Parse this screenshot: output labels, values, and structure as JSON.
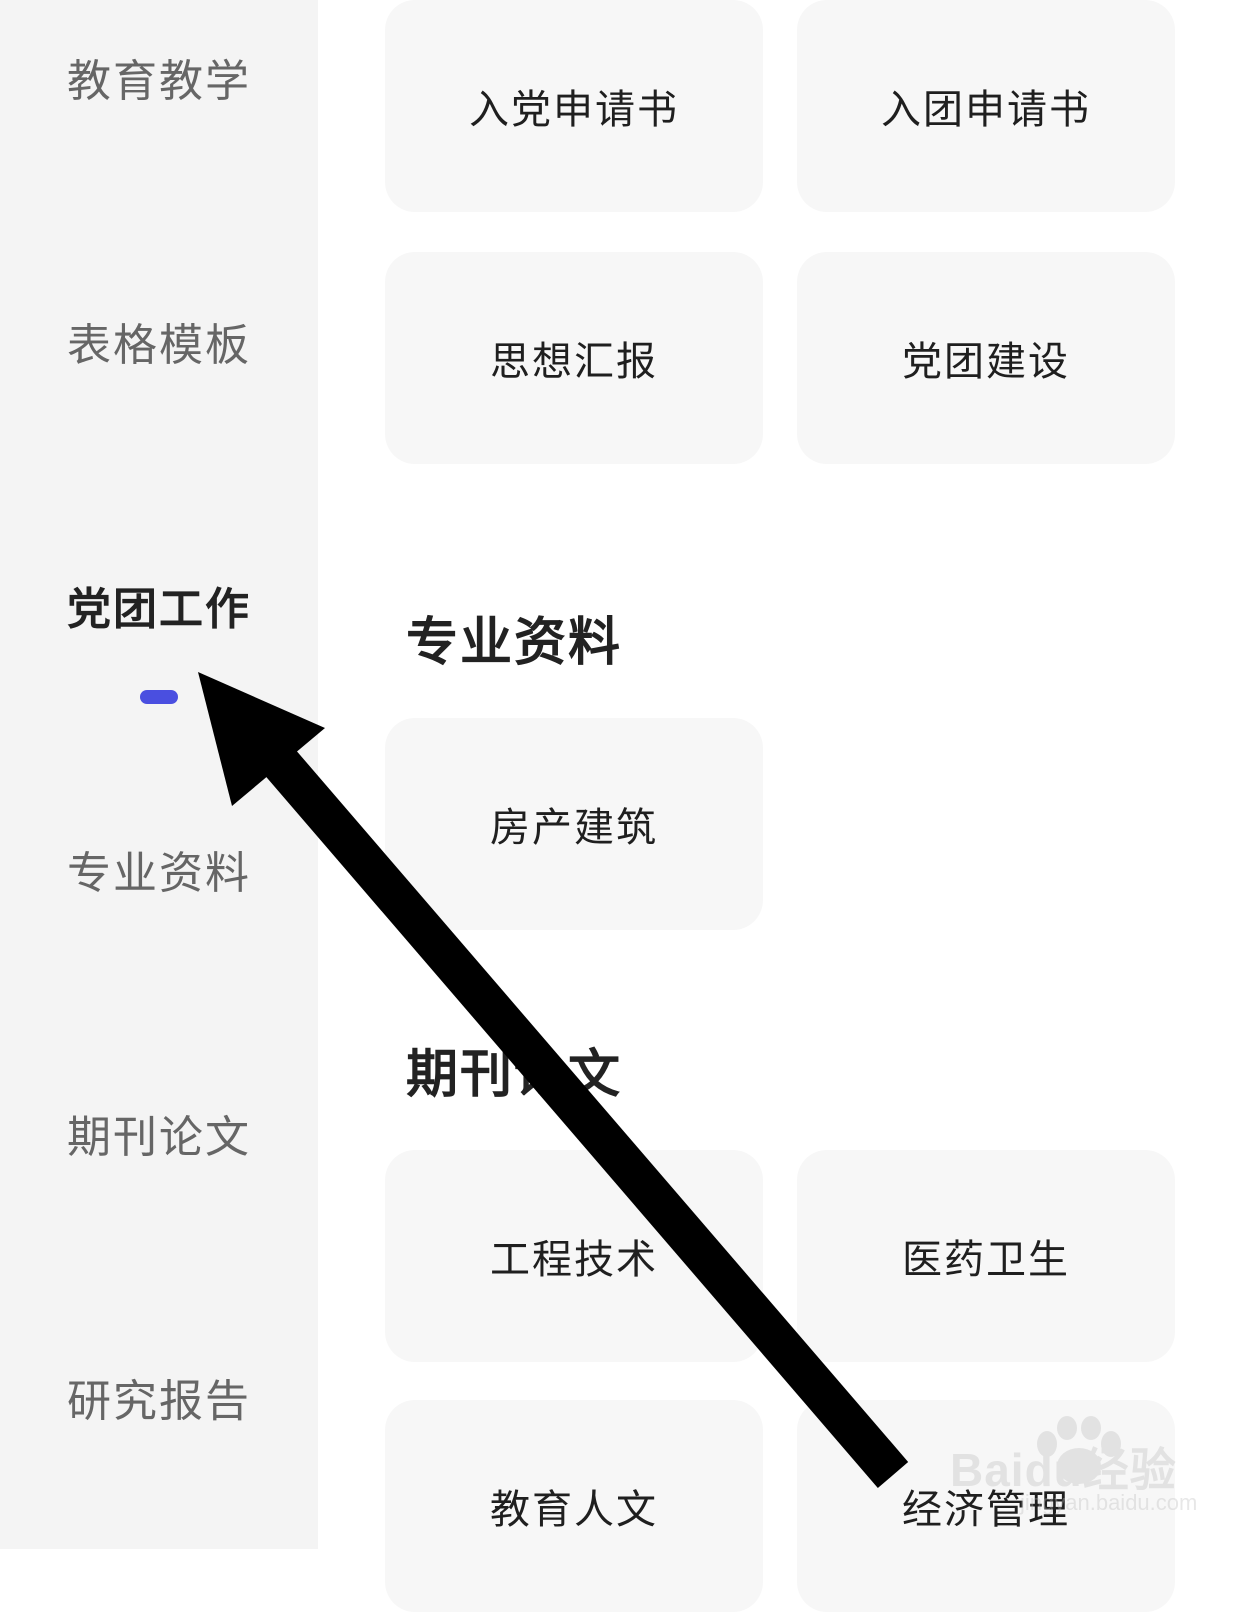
{
  "sidebar": {
    "items": [
      {
        "label": "教育教学"
      },
      {
        "label": "表格模板"
      },
      {
        "label": "党团工作"
      },
      {
        "label": "专业资料"
      },
      {
        "label": "期刊论文"
      },
      {
        "label": "研究报告"
      }
    ],
    "active_index": 2,
    "accent_color": "#4a4fe0"
  },
  "party_work": {
    "cards": [
      {
        "label": "入党申请书"
      },
      {
        "label": "入团申请书"
      },
      {
        "label": "思想汇报"
      },
      {
        "label": "党团建设"
      }
    ]
  },
  "professional": {
    "title": "专业资料",
    "cards": [
      {
        "label": "房产建筑"
      }
    ]
  },
  "journals": {
    "title": "期刊论文",
    "cards": [
      {
        "label": "工程技术"
      },
      {
        "label": "医药卫生"
      },
      {
        "label": "教育人文"
      },
      {
        "label": "经济管理"
      }
    ]
  },
  "overlay": {
    "annotation": "arrow-pointing-to-active-sidebar-item",
    "watermark_brand": "Baidu经验",
    "watermark_url": "jingyan.baidu.com"
  }
}
